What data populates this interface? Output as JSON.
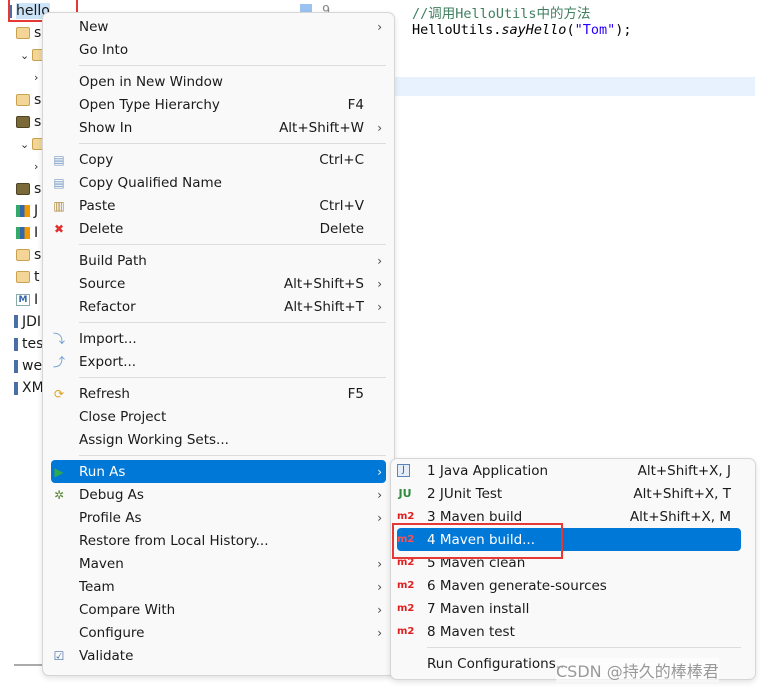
{
  "tree": {
    "rows": [
      {
        "label": "hello",
        "icon": "project-icon"
      },
      {
        "label": "s",
        "icon": "source-folder-icon"
      },
      {
        "label": "",
        "icon": "package-icon",
        "chevron": "expanded"
      },
      {
        "label": "",
        "icon": "",
        "chevron": "collapsed"
      },
      {
        "label": "s",
        "icon": "source-folder-icon"
      },
      {
        "label": "s",
        "icon": "package-folder-icon"
      },
      {
        "label": "",
        "icon": "package-icon",
        "chevron": "expanded"
      },
      {
        "label": "",
        "icon": "",
        "chevron": "collapsed"
      },
      {
        "label": "s",
        "icon": "package-folder-icon"
      },
      {
        "label": "J",
        "icon": "library-icon"
      },
      {
        "label": "I",
        "icon": "library-icon"
      },
      {
        "label": "s",
        "icon": "folder-icon"
      },
      {
        "label": "t",
        "icon": "folder-icon"
      },
      {
        "label": "I",
        "icon": "maven-file-icon"
      },
      {
        "label": "JDI",
        "icon": "jar-icon"
      },
      {
        "label": "tes",
        "icon": "jar-icon"
      },
      {
        "label": "we",
        "icon": "jar-icon"
      },
      {
        "label": "XM",
        "icon": "jar-icon"
      }
    ]
  },
  "editor": {
    "line_number": "9",
    "comment": "//调用HelloUtils中的方法",
    "code_class": "HelloUtils.",
    "code_method": "sayHello",
    "code_open": "(",
    "code_string": "\"Tom\"",
    "code_close": ");"
  },
  "context_menu": {
    "items": [
      {
        "label": "New",
        "submenu": true
      },
      {
        "label": "Go Into"
      },
      {
        "sep": true
      },
      {
        "label": "Open in New Window"
      },
      {
        "label": "Open Type Hierarchy",
        "shortcut": "F4"
      },
      {
        "label": "Show In",
        "shortcut": "Alt+Shift+W",
        "submenu": true
      },
      {
        "sep": true
      },
      {
        "label": "Copy",
        "shortcut": "Ctrl+C",
        "icon": "copy-icon"
      },
      {
        "label": "Copy Qualified Name",
        "icon": "copy-qualified-name-icon"
      },
      {
        "label": "Paste",
        "shortcut": "Ctrl+V",
        "icon": "paste-icon"
      },
      {
        "label": "Delete",
        "shortcut": "Delete",
        "icon": "delete-icon"
      },
      {
        "sep": true
      },
      {
        "label": "Build Path",
        "submenu": true
      },
      {
        "label": "Source",
        "shortcut": "Alt+Shift+S",
        "submenu": true
      },
      {
        "label": "Refactor",
        "shortcut": "Alt+Shift+T",
        "submenu": true
      },
      {
        "sep": true
      },
      {
        "label": "Import...",
        "icon": "import-icon"
      },
      {
        "label": "Export...",
        "icon": "export-icon"
      },
      {
        "sep": true
      },
      {
        "label": "Refresh",
        "shortcut": "F5",
        "icon": "refresh-icon"
      },
      {
        "label": "Close Project"
      },
      {
        "label": "Assign Working Sets..."
      },
      {
        "sep": true
      },
      {
        "label": "Run As",
        "submenu": true,
        "icon": "run-icon",
        "selected": true
      },
      {
        "label": "Debug As",
        "submenu": true,
        "icon": "debug-icon"
      },
      {
        "label": "Profile As",
        "submenu": true
      },
      {
        "label": "Restore from Local History..."
      },
      {
        "label": "Maven",
        "submenu": true
      },
      {
        "label": "Team",
        "submenu": true
      },
      {
        "label": "Compare With",
        "submenu": true
      },
      {
        "label": "Configure",
        "submenu": true
      },
      {
        "label": "Validate",
        "icon": "validate-check-icon"
      }
    ]
  },
  "run_as_menu": {
    "items": [
      {
        "label": "1 Java Application",
        "shortcut": "Alt+Shift+X, J",
        "icon": "java-application-icon"
      },
      {
        "label": "2 JUnit Test",
        "shortcut": "Alt+Shift+X, T",
        "icon": "junit-icon"
      },
      {
        "label": "3 Maven build",
        "shortcut": "Alt+Shift+X, M",
        "icon": "maven-m2-icon"
      },
      {
        "label": "4 Maven build...",
        "icon": "maven-m2-icon",
        "selected": true
      },
      {
        "label": "5 Maven clean",
        "icon": "maven-m2-icon"
      },
      {
        "label": "6 Maven generate-sources",
        "icon": "maven-m2-icon"
      },
      {
        "label": "7 Maven install",
        "icon": "maven-m2-icon"
      },
      {
        "label": "8 Maven test",
        "icon": "maven-m2-icon"
      },
      {
        "sep": true
      },
      {
        "label": "Run Configurations..."
      }
    ]
  },
  "watermark": "CSDN @持久的棒棒君",
  "colors": {
    "selection": "#0078d7",
    "highlight_box": "#e53935",
    "maven": "#e02020"
  }
}
